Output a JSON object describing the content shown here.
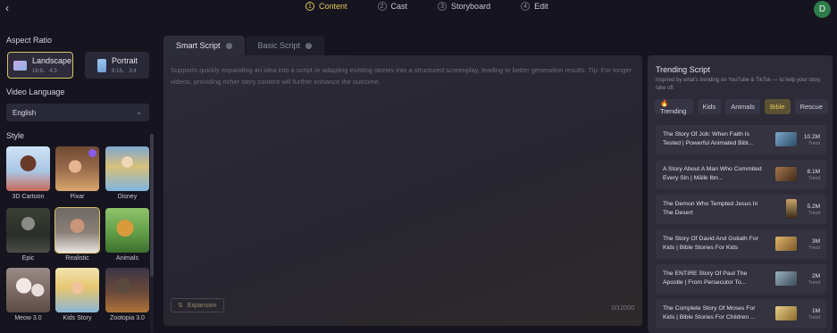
{
  "header": {
    "back_icon": "chevron-left-icon",
    "steps": [
      {
        "num": "1",
        "label": "Content",
        "active": true
      },
      {
        "num": "2",
        "label": "Cast",
        "active": false
      },
      {
        "num": "3",
        "label": "Storyboard",
        "active": false
      },
      {
        "num": "4",
        "label": "Edit",
        "active": false
      }
    ],
    "avatar_initial": "D",
    "avatar_color": "#2f7d4a"
  },
  "sidebar": {
    "aspect_ratio_title": "Aspect Ratio",
    "ratios": [
      {
        "name": "Landscape",
        "sub": "16:9、 4:3",
        "active": true
      },
      {
        "name": "Portrait",
        "sub": "9:16、 3:4",
        "active": false
      }
    ],
    "video_language_title": "Video Language",
    "language_value": "English",
    "style_title": "Style",
    "styles": [
      {
        "label": "3D Cartoon",
        "active": false,
        "hot": false
      },
      {
        "label": "Pixar",
        "active": false,
        "hot": true
      },
      {
        "label": "Disney",
        "active": false,
        "hot": false
      },
      {
        "label": "Epic",
        "active": false,
        "hot": false
      },
      {
        "label": "Realistic",
        "active": true,
        "hot": false
      },
      {
        "label": "Animals",
        "active": false,
        "hot": false
      },
      {
        "label": "Meow 3.0",
        "active": false,
        "hot": false
      },
      {
        "label": "Kids Story",
        "active": false,
        "hot": false
      },
      {
        "label": "Zootopia 3.0",
        "active": false,
        "hot": false
      }
    ]
  },
  "editor": {
    "tabs": [
      {
        "label": "Smart Script",
        "active": true
      },
      {
        "label": "Basic Script",
        "active": false
      }
    ],
    "placeholder": "Supports quickly expanding an idea into a script or adapting existing stories into a structured screenplay, leading to better generation results. Tip: For longer videos, providing richer story content will further enhance the outcome.",
    "expansion_label": "Expansion",
    "counter": "0/12000"
  },
  "trending": {
    "title": "Trending Script",
    "description": "Inspired by what’s trending on YouTube & TikTok — to help your story take off.",
    "chips": [
      {
        "label": "🔥Trending",
        "active": false
      },
      {
        "label": "Kids",
        "active": false
      },
      {
        "label": "Animals",
        "active": false
      },
      {
        "label": "Bible",
        "active": true
      },
      {
        "label": "Rescue",
        "active": false
      }
    ],
    "items": [
      {
        "title": "The Story Of Job: When Faith Is Tested | Powerful Animated Bibl...",
        "value": "10.2M",
        "stat_label": "Trend"
      },
      {
        "title": "A Story About A Man Who Commited Every Sin | Mālik Ibn...",
        "value": "8.1M",
        "stat_label": "Trend"
      },
      {
        "title": "The Demon Who Tempted Jesus In The Desert",
        "value": "5.2M",
        "stat_label": "Trend"
      },
      {
        "title": "The Story Of David And Goliath For Kids | Bible Stories For Kids",
        "value": "3M",
        "stat_label": "Trend"
      },
      {
        "title": "The ENTIRE Story Of Paul The Apostle | From Persecutor To...",
        "value": "2M",
        "stat_label": "Trend"
      },
      {
        "title": "The Complete Story Of Moses For Kids | Bible Stories For Children ...",
        "value": "1M",
        "stat_label": "Trend"
      }
    ]
  },
  "colors": {
    "accent": "#e4c75a",
    "background": "#16151f",
    "panel": "#2c2b37"
  }
}
